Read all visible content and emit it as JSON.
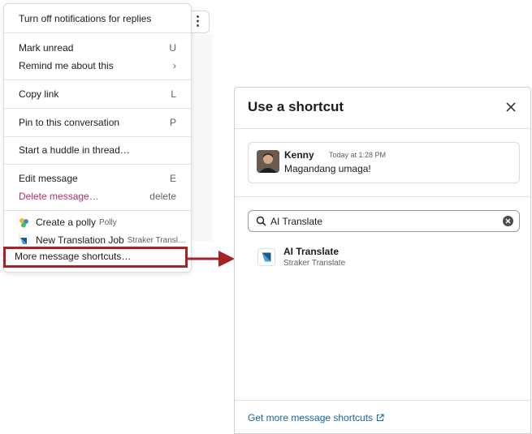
{
  "context_menu": {
    "more_actions_icon": "vertical-ellipsis",
    "items": [
      {
        "label": "Turn off notifications for replies",
        "shortcut": ""
      },
      {
        "label": "Mark unread",
        "shortcut": "U"
      },
      {
        "label": "Remind me about this",
        "shortcut": "›"
      },
      {
        "label": "Copy link",
        "shortcut": "L"
      },
      {
        "label": "Pin to this conversation",
        "shortcut": "P"
      },
      {
        "label": "Start a huddle in thread…",
        "shortcut": ""
      },
      {
        "label": "Edit message",
        "shortcut": "E"
      },
      {
        "label": "Delete message…",
        "shortcut": "delete"
      }
    ],
    "apps": [
      {
        "label": "Create a polly",
        "sub": "Polly",
        "icon": "polly-icon"
      },
      {
        "label": "New Translation Job",
        "sub": "Straker Transl…",
        "icon": "straker-icon"
      }
    ],
    "more_shortcuts": "More message shortcuts…",
    "danger_color": "#a8326a",
    "highlight_color": "#a72228"
  },
  "modal": {
    "title": "Use a shortcut",
    "message": {
      "author": "Kenny",
      "time": "Today at 1:28 PM",
      "text": "Magandang umaga!"
    },
    "search": {
      "value": "AI Translate",
      "placeholder": ""
    },
    "results": [
      {
        "title": "AI Translate",
        "subtitle": "Straker Translate"
      }
    ],
    "footer_link": "Get more message shortcuts",
    "link_color": "#1264a3"
  }
}
